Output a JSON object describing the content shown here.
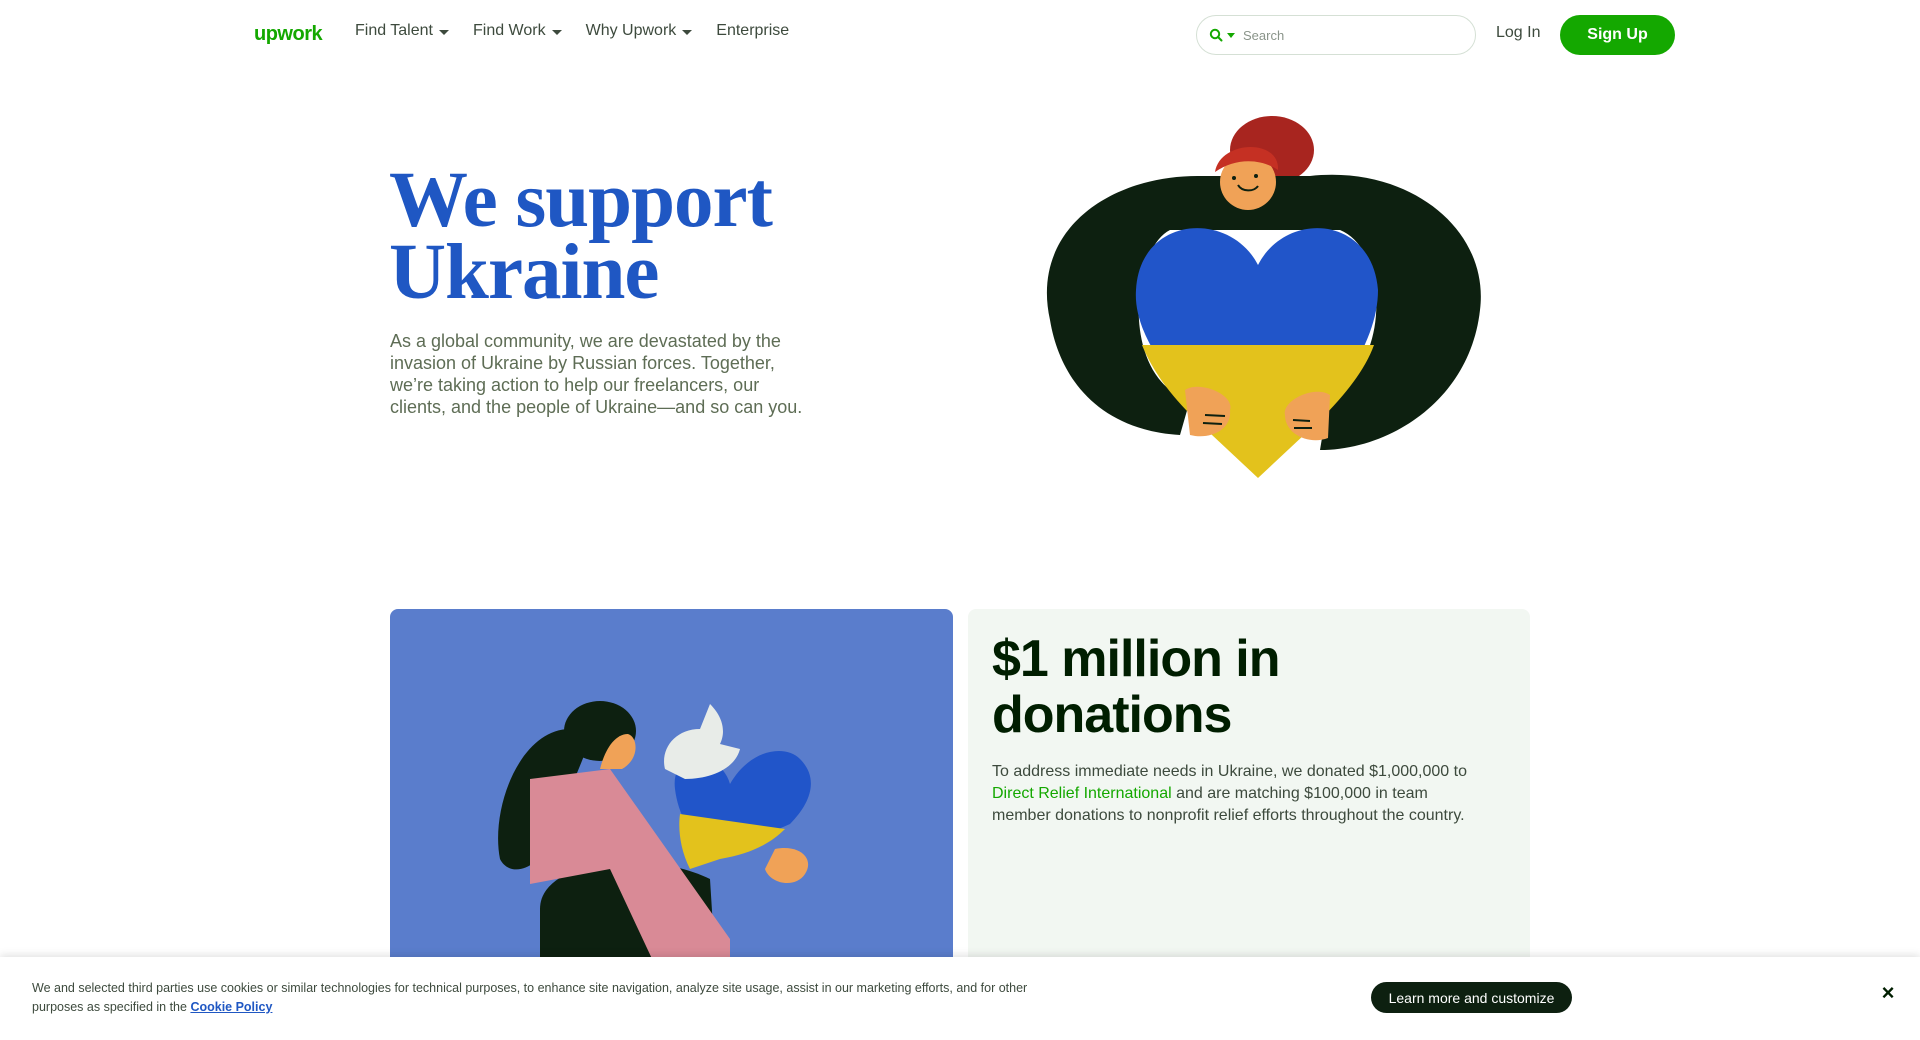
{
  "header": {
    "logo_text": "upwork",
    "nav": [
      {
        "label": "Find Talent",
        "has_dropdown": true
      },
      {
        "label": "Find Work",
        "has_dropdown": true
      },
      {
        "label": "Why Upwork",
        "has_dropdown": true
      },
      {
        "label": "Enterprise",
        "has_dropdown": false
      }
    ],
    "search": {
      "placeholder": "Search",
      "icon": "search-icon"
    },
    "login_label": "Log In",
    "signup_label": "Sign Up"
  },
  "hero": {
    "title_line1": "We support",
    "title_line2": "Ukraine",
    "text": "As a global community, we are devastated by the invasion of Ukraine by Russian forces. Together, we’re taking action to help our freelancers, our clients, and the people of Ukraine—and so can you."
  },
  "donations_card": {
    "title": "$1 million in donations",
    "text_before": "To address immediate needs in Ukraine, we donated $1,000,000 to ",
    "link_text": "Direct Relief International",
    "text_after": " and are matching $100,000 in team member donations to nonprofit relief efforts throughout the country."
  },
  "cookie_banner": {
    "text": "We and selected third parties use cookies or similar technologies for technical purposes, to enhance site navigation, analyze site usage, assist in our marketing efforts, and for other purposes as specified in the ",
    "link_text": "Cookie Policy",
    "button_label": "Learn more and customize",
    "close_icon": "close-icon"
  },
  "colors": {
    "brand_green": "#14a800",
    "hero_blue": "#1f57c3",
    "ukraine_blue": "#2155c9",
    "ukraine_yellow": "#e3c21c",
    "card_blue_bg": "#5a7dcc",
    "card_green_bg": "#f2f7f2"
  }
}
